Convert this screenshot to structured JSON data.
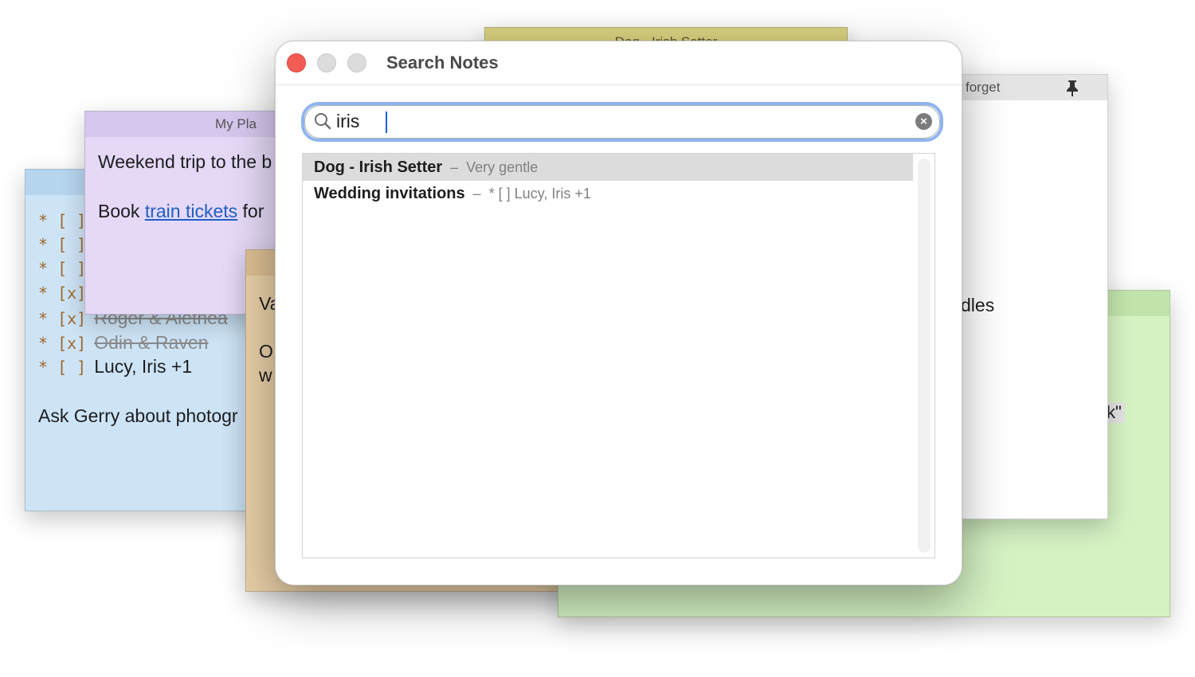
{
  "background_notes": {
    "yellow": {
      "title": "Dog - Irish Setter",
      "color": "#dcd48a"
    },
    "purple": {
      "title": "My Pla",
      "line1": "Weekend trip to the b",
      "line2_prefix": "Book ",
      "line2_link": "train tickets",
      "line2_suffix": " for",
      "color": "#e5d9f7"
    },
    "blue": {
      "checklist": [
        {
          "mark": "* [  ]",
          "text": "",
          "done": false
        },
        {
          "mark": "* [  ]",
          "text": "",
          "done": false
        },
        {
          "mark": "* [  ]",
          "text": "",
          "done": false
        },
        {
          "mark": "* [x]",
          "text": "",
          "done": true
        },
        {
          "mark": "* [x]",
          "text": "Roger & Aletnea",
          "done": true
        },
        {
          "mark": "* [x]",
          "text": "Odin & Raven",
          "done": true
        },
        {
          "mark": "* [  ]",
          "text": "Lucy, Iris +1",
          "done": false
        }
      ],
      "footer": "Ask Gerry about photogr",
      "color": "#cde4f6"
    },
    "tan": {
      "line1": "Va",
      "line2": "O",
      "line3": "w",
      "color": "#e8cfa7"
    },
    "white": {
      "title": "forget",
      "partial_text": "dles",
      "color": "#ffffff"
    },
    "green": {
      "partial_text": "k\"",
      "color": "#d5f2c3"
    }
  },
  "dialog": {
    "title": "Search Notes",
    "search": {
      "value": "iris",
      "placeholder": ""
    },
    "results": [
      {
        "title": "Dog - Irish Setter",
        "dash": "–",
        "snippet": "Very gentle",
        "selected": true
      },
      {
        "title": "Wedding invitations",
        "dash": "–",
        "snippet": "* [ ] Lucy, Iris +1",
        "selected": false
      }
    ]
  },
  "icons": {
    "close": "close-traffic-light",
    "search": "magnifier-icon",
    "clear": "clear-circle-icon",
    "pin": "pushpin-icon"
  },
  "colors": {
    "focus_ring": "#8db4ee",
    "close_button": "#f25c54",
    "selection": "#dcdcdc",
    "link": "#1f5fc4"
  }
}
